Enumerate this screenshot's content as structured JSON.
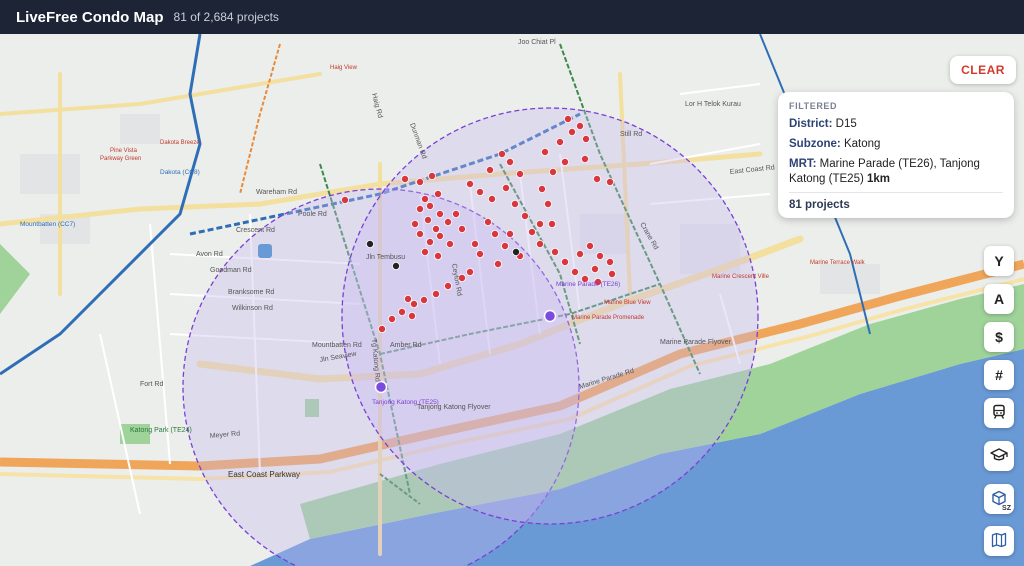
{
  "header": {
    "title": "LiveFree Condo Map",
    "count": "81 of 2,684 projects"
  },
  "clear_label": "CLEAR",
  "filter": {
    "heading": "FILTERED",
    "district_label": "District:",
    "district_value": "D15",
    "subzone_label": "Subzone:",
    "subzone_value": "Katong",
    "mrt_label": "MRT:",
    "mrt_value": "Marine Parade (TE26), Tanjong Katong (TE25)",
    "mrt_radius": "1km",
    "total": "81 projects"
  },
  "side_buttons": [
    {
      "name": "year-filter-button",
      "label": "Y"
    },
    {
      "name": "area-filter-button",
      "label": "A"
    },
    {
      "name": "price-filter-button",
      "label": "$"
    },
    {
      "name": "units-filter-button",
      "label": "#"
    },
    {
      "name": "mrt-filter-button",
      "icon": "train-icon"
    },
    {
      "name": "school-filter-button",
      "icon": "graduation-cap-icon"
    },
    {
      "name": "subzone-filter-button",
      "icon": "cube-icon",
      "badge": "SZ"
    },
    {
      "name": "map-layer-button",
      "icon": "map-icon"
    }
  ],
  "map_labels": {
    "roads": [
      "East Coast Parkway",
      "Marine Parade Rd",
      "East Coast Rd",
      "Tg Katong Rd",
      "Amber Rd",
      "Meyer Rd",
      "Joo Chiat Pl",
      "Jln Tembusu",
      "Goodman Rd",
      "Branksome Rd",
      "Wilkinson Rd",
      "Ceylon Rd",
      "Crane Rd",
      "Still Rd",
      "Lor H Telok Kurau",
      "Marine Parade Flyover",
      "Tanjong Katong Flyover",
      "Dunman Rd",
      "Haig Rd",
      "Mountbatten Rd",
      "Fort Rd",
      "Wareham Rd",
      "Poole Rd",
      "Crescent Rd",
      "Avon Rd",
      "Jln Seaview",
      "Katong Park (TE24)"
    ],
    "stations": [
      "Tanjong Katong (TE25)",
      "Marine Parade (TE26)",
      "Dakota (CC8)",
      "Mountbatten (CC7)"
    ],
    "places": [
      "Marine Parade Promenade",
      "Marine Crescent Ville",
      "Marine Terrace Walk",
      "Marine Blue View",
      "Dakota Breeze",
      "Haig View",
      "Pine Vista",
      "Parkway Green"
    ]
  },
  "colors": {
    "header_bg": "#1c2435",
    "condo_marker": "#d9363e",
    "other_marker": "#222222",
    "mrt_marker": "#7b4be0",
    "radius_ring": "#7a3fd6",
    "sea": "#6a9ad6",
    "park": "#9fd39a",
    "expressway": "#f0a65a",
    "mrt_line": "#2f6db5"
  }
}
